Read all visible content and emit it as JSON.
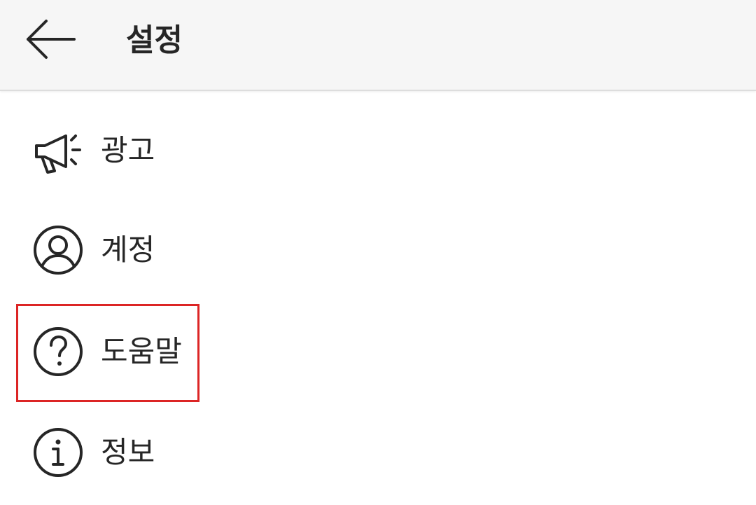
{
  "header": {
    "title": "설정",
    "back_icon": "arrow-left-icon"
  },
  "menu": {
    "items": [
      {
        "label": "광고",
        "icon": "megaphone-icon"
      },
      {
        "label": "계정",
        "icon": "account-circle-icon"
      },
      {
        "label": "도움말",
        "icon": "help-circle-icon"
      },
      {
        "label": "정보",
        "icon": "info-circle-icon"
      }
    ]
  },
  "colors": {
    "header_bg": "#f6f6f6",
    "text": "#262626",
    "highlight": "#dc2525"
  }
}
